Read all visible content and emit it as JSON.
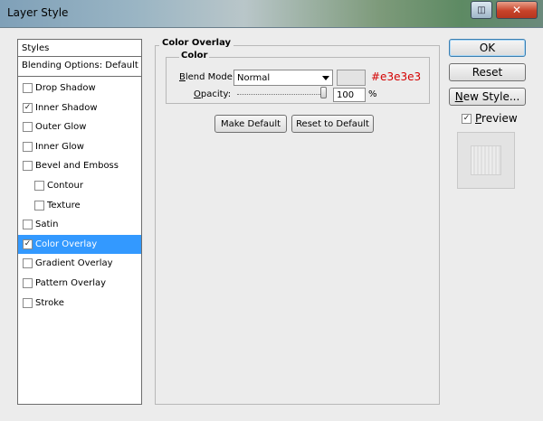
{
  "window": {
    "title": "Layer Style"
  },
  "styles_panel": {
    "header": "Styles",
    "blending_options": "Blending Options: Default",
    "items": [
      {
        "label": "Drop Shadow",
        "checked": false,
        "indent": false,
        "selected": false
      },
      {
        "label": "Inner Shadow",
        "checked": true,
        "indent": false,
        "selected": false
      },
      {
        "label": "Outer Glow",
        "checked": false,
        "indent": false,
        "selected": false
      },
      {
        "label": "Inner Glow",
        "checked": false,
        "indent": false,
        "selected": false
      },
      {
        "label": "Bevel and Emboss",
        "checked": false,
        "indent": false,
        "selected": false
      },
      {
        "label": "Contour",
        "checked": false,
        "indent": true,
        "selected": false
      },
      {
        "label": "Texture",
        "checked": false,
        "indent": true,
        "selected": false
      },
      {
        "label": "Satin",
        "checked": false,
        "indent": false,
        "selected": false
      },
      {
        "label": "Color Overlay",
        "checked": true,
        "indent": false,
        "selected": true
      },
      {
        "label": "Gradient Overlay",
        "checked": false,
        "indent": false,
        "selected": false
      },
      {
        "label": "Pattern Overlay",
        "checked": false,
        "indent": false,
        "selected": false
      },
      {
        "label": "Stroke",
        "checked": false,
        "indent": false,
        "selected": false
      }
    ]
  },
  "color_overlay": {
    "section_title": "Color Overlay",
    "group_title": "Color",
    "blend_mode_label_prefix": "B",
    "blend_mode_label_rest": "lend Mode:",
    "blend_mode_value": "Normal",
    "color_hex_label": "#e3e3e3",
    "swatch_color": "#e3e3e3",
    "opacity_label_prefix": "O",
    "opacity_label_rest": "pacity:",
    "opacity_value": "100",
    "opacity_unit": "%",
    "make_default": "Make Default",
    "reset_default": "Reset to Default"
  },
  "right_panel": {
    "ok": "OK",
    "reset": "Reset",
    "new_style_prefix": "N",
    "new_style_rest": "ew Style...",
    "preview_label_prefix": "P",
    "preview_label_rest": "review",
    "preview_checked": true
  },
  "colors": {
    "selection": "#3399ff",
    "hex_text": "#d40000"
  }
}
